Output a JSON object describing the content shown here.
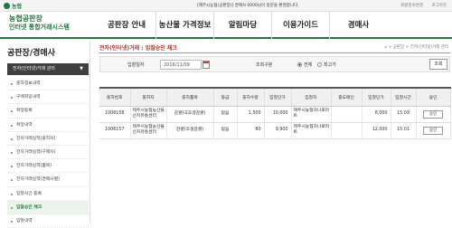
{
  "topbar": {
    "logo": "농협",
    "message": "[제주시농협(공판장)] 경매사 0000님이 방문을 환영합니다.",
    "util": [
      "회원정보변경",
      "로그아웃"
    ]
  },
  "header": {
    "brand_line1": "농협공판장",
    "brand_line2": "인터넷 통합거래시스템",
    "nav": [
      "공판장 안내",
      "농산물 가격정보",
      "알림마당",
      "이용가이드",
      "경매사"
    ]
  },
  "sidebar": {
    "title": "공판장/경매사",
    "head": "전자(인터넷)거래 관리",
    "items": [
      "출하정보내역",
      "구매희망내역",
      "확정등록",
      "확정내역",
      "전자거래실적(출하자)",
      "전자거래실적(구매자)",
      "전자거래실적(품목)",
      "전자거래실적(경매사별)",
      "입찰시간 등록",
      "입찰승인 체크",
      "입찰내역"
    ],
    "active_index": 9
  },
  "main": {
    "page_title": "전자(인터넷)거래 : 입찰승인 체크",
    "breadcrumb": "⌂ > 공판장 > 전자(인터넷)거래 관리",
    "search": {
      "date_label": "입찰일자",
      "date_value": "2016/11/09",
      "type_label": "조회구분",
      "option_all": "전체",
      "option_recent": "최고가",
      "search_button": "조회"
    },
    "table": {
      "headers": [
        "출하번호",
        "출하자",
        "출하품목",
        "등급",
        "출하수량",
        "입찰단가",
        "입찰자",
        "중도매인",
        "입찰단가",
        "입찰시간",
        "승인"
      ],
      "rows": [
        [
          "1006158",
          "제주시농협농산물산지유통센터",
          "감귤(극조생감귤)",
          "없음",
          "1,500",
          "10,000",
          "제주시농협자나로마트",
          "",
          "8,000",
          "15:09",
          "승인"
        ],
        [
          "1006157",
          "제주시농협농산물산지유통센터",
          "감귤(조생감귤)",
          "없음",
          "80",
          "9,900",
          "제주시농협자나로마트",
          "",
          "12,000",
          "15:01",
          "승인"
        ]
      ]
    }
  }
}
